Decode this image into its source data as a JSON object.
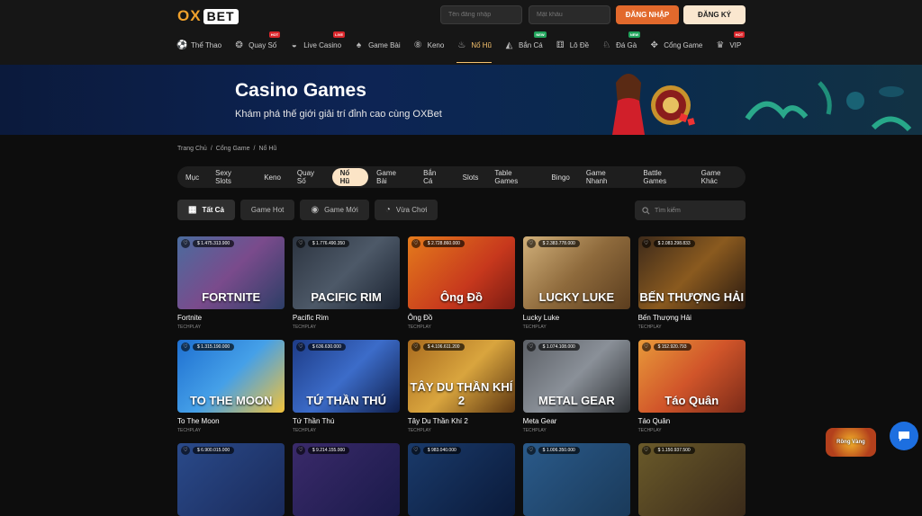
{
  "logo": {
    "ox": "OX",
    "bet": "BET"
  },
  "auth": {
    "username_placeholder": "Tên đăng nhập",
    "password_placeholder": "Mật khẩu",
    "login_label": "ĐĂNG NHẬP",
    "register_label": "ĐĂNG KÝ"
  },
  "nav": [
    {
      "label": "Thể Thao",
      "icon": "soccer-ball-icon"
    },
    {
      "label": "Quay Số",
      "icon": "lottery-ball-icon",
      "badge": "HOT"
    },
    {
      "label": "Live Casino",
      "icon": "mask-icon",
      "badge": "LIVE"
    },
    {
      "label": "Game Bài",
      "icon": "spade-icon"
    },
    {
      "label": "Keno",
      "icon": "keno-ball-icon"
    },
    {
      "label": "Nổ Hũ",
      "icon": "slot-pot-icon",
      "active": true
    },
    {
      "label": "Bắn Cá",
      "icon": "fish-icon",
      "badge": "NEW"
    },
    {
      "label": "Lô Đề",
      "icon": "dice-icon"
    },
    {
      "label": "Đá Gà",
      "icon": "rooster-icon",
      "badge": "NEW"
    },
    {
      "label": "Cổng Game",
      "icon": "gamepad-icon"
    },
    {
      "label": "VIP",
      "icon": "crown-icon",
      "badge": "HOT"
    }
  ],
  "banner": {
    "title": "Casino Games",
    "subtitle": "Khám phá thế giới giải trí đỉnh cao cùng OXBet"
  },
  "breadcrumb": [
    "Trang Chủ",
    "/",
    "Cổng Game",
    "/",
    "Nổ Hũ"
  ],
  "categories": [
    "Mục",
    "Sexy Slots",
    "Keno",
    "Quay Số",
    "Nổ Hũ",
    "Game Bài",
    "Bắn Cá",
    "Slots",
    "Table Games",
    "Bingo",
    "Game Nhanh",
    "Battle Games",
    "Game Khác"
  ],
  "active_category": "Nổ Hũ",
  "filters": [
    {
      "label": "Tất Cả",
      "icon": "grid-icon",
      "active": true
    },
    {
      "label": "Game Hot",
      "icon": ""
    },
    {
      "label": "Game Mới",
      "icon": "game-new-icon"
    },
    {
      "label": "Vừa Chơi",
      "icon": "recent-icon"
    }
  ],
  "search": {
    "placeholder": "Tìm kiếm"
  },
  "games": [
    {
      "name": "Fortnite",
      "provider": "TECHPLAY",
      "jackpot": "$ 1.475.313.900",
      "art": "FORTNITE",
      "bg": "linear-gradient(135deg,#4a6c9e 0%,#7a4b8c 50%,#2c3e66 100%)"
    },
    {
      "name": "Pacific Rim",
      "provider": "TECHPLAY",
      "jackpot": "$ 1.776.490.350",
      "art": "PACIFIC RIM",
      "bg": "linear-gradient(135deg,#2c3440 0%,#4d5968 50%,#1a2230 100%)"
    },
    {
      "name": "Ông Đồ",
      "provider": "TECHPLAY",
      "jackpot": "$ 2.728.860.000",
      "art": "Ông Đồ",
      "bg": "linear-gradient(135deg,#e47b1c 0%,#c7381d 60%,#7a1b12 100%)"
    },
    {
      "name": "Lucky Luke",
      "provider": "TECHPLAY",
      "jackpot": "$ 2.383.778.000",
      "art": "LUCKY LUKE",
      "bg": "linear-gradient(135deg,#d1b07a 0%,#8e6a3c 50%,#5b3d1e 100%)"
    },
    {
      "name": "Bến Thượng Hải",
      "provider": "TECHPLAY",
      "jackpot": "$ 2.083.298.833",
      "art": "BẾN THƯỢNG HẢI",
      "bg": "linear-gradient(135deg,#3d2a1a 0%,#8a5a1f 50%,#2a1a10 100%)"
    },
    {
      "name": "To The Moon",
      "provider": "TECHPLAY",
      "jackpot": "$ 1.315.190.000",
      "art": "TO THE MOON",
      "bg": "linear-gradient(135deg,#1e6fd0 0%,#45a0e8 50%,#f2c23a 100%)"
    },
    {
      "name": "Tứ Thần Thú",
      "provider": "TECHPLAY",
      "jackpot": "$ 636.630.000",
      "art": "TỨ THẦN THÚ",
      "bg": "linear-gradient(135deg,#1d3b86 0%,#3c6cc9 50%,#0f1e4a 100%)"
    },
    {
      "name": "Tây Du Thần Khí 2",
      "provider": "TECHPLAY",
      "jackpot": "$ 4.106.611.200",
      "art": "TÂY DU THẦN KHÍ 2",
      "bg": "linear-gradient(135deg,#a86a1e 0%,#d9a53e 50%,#5a3410 100%)"
    },
    {
      "name": "Meta Gear",
      "provider": "TECHPLAY",
      "jackpot": "$ 1.074.108.000",
      "art": "METAL GEAR",
      "bg": "linear-gradient(135deg,#5c6066 0%,#8a9098 50%,#2d3034 100%)"
    },
    {
      "name": "Táo Quân",
      "provider": "TECHPLAY",
      "jackpot": "$ 152.920.793",
      "art": "Táo Quân",
      "bg": "linear-gradient(135deg,#e89a3a 0%,#d1552a 50%,#7a2a18 100%)"
    },
    {
      "name": "",
      "provider": "",
      "jackpot": "$ 6.900.015.000",
      "art": "",
      "bg": "linear-gradient(135deg,#2a4a8a 0%,#1a2a5a 100%)"
    },
    {
      "name": "",
      "provider": "",
      "jackpot": "$ 9.214.155.000",
      "art": "",
      "bg": "linear-gradient(135deg,#3a2a6a 0%,#1a1a4a 100%)"
    },
    {
      "name": "",
      "provider": "",
      "jackpot": "$ 983.040.000",
      "art": "",
      "bg": "linear-gradient(135deg,#1a3a6a 0%,#0a1a3a 100%)"
    },
    {
      "name": "",
      "provider": "",
      "jackpot": "$ 1.006.350.000",
      "art": "",
      "bg": "linear-gradient(135deg,#2a5a8a 0%,#1a3a5a 100%)"
    },
    {
      "name": "",
      "provider": "",
      "jackpot": "$ 1.150.937.500",
      "art": "",
      "bg": "linear-gradient(135deg,#6a5a2a 0%,#3a2a1a 100%)"
    }
  ],
  "promo_widget": {
    "label": "Rồng Vàng"
  },
  "colors": {
    "accent": "#e2692c",
    "active_nav": "#f6c26d",
    "chip_active": "#fbe4c6",
    "chat": "#1d6fe0"
  }
}
